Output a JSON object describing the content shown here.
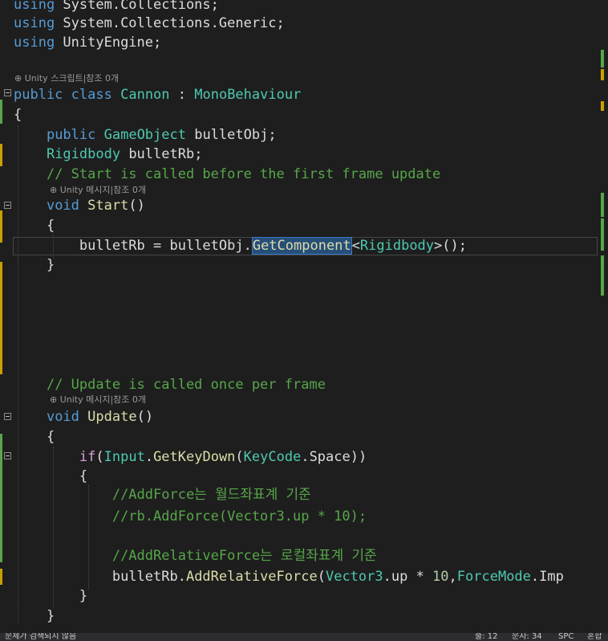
{
  "editor": {
    "lines": {
      "using1_kw": "using",
      "using1_ns": " System.Collections;",
      "using2_kw": "using",
      "using2_ns": " System.Collections.Generic;",
      "using3_kw": "using",
      "using3_ns": " UnityEngine;",
      "class_public": "public",
      "class_kw": "class",
      "class_name": "Cannon",
      "class_colon": " : ",
      "class_base": "MonoBehaviour",
      "open_brace": "{",
      "field1_public": "public",
      "field1_type": "GameObject",
      "field1_name": " bulletObj;",
      "field2_type": "Rigidbody",
      "field2_name": " bulletRb;",
      "comment_start": "// Start is called before the first frame update",
      "start_void": "void",
      "start_name": "Start",
      "start_parens": "()",
      "start_open": "{",
      "assign_lhs": "bulletRb = bulletObj.",
      "assign_method": "GetComponent",
      "assign_lt": "<",
      "assign_type": "Rigidbody",
      "assign_rest": ">();",
      "start_close": "}",
      "comment_update": "// Update is called once per frame",
      "update_void": "void",
      "update_name": "Update",
      "update_parens": "()",
      "update_open": "{",
      "if_kw": "if",
      "if_paren": "(",
      "if_input": "Input",
      "if_dot1": ".",
      "if_method": "GetKeyDown",
      "if_paren2": "(",
      "if_keycode": "KeyCode",
      "if_rest": ".Space))",
      "if_open": "{",
      "comment_addforce": "//AddForce는 월드좌표계 기준",
      "comment_rb": "//rb.AddForce(Vector3.up * 10);",
      "comment_relative": "//AddRelativeForce는 로컬좌표계 기준",
      "call_obj": "bulletRb.",
      "call_method": "AddRelativeForce",
      "call_paren": "(",
      "call_vec": "Vector3",
      "call_up": ".up * ",
      "call_num": "10",
      "call_comma": ",",
      "call_mode": "ForceMode",
      "call_tail": ".Imp",
      "if_close": "}",
      "update_close": "}"
    },
    "codelens": {
      "class_lens": "⊕ Unity 스크립트|참조 0개",
      "start_lens": "⊕ Unity 메시지|참조 0개",
      "update_lens": "⊕ Unity 메시지|참조 0개"
    },
    "colors": {
      "background": "#1e1e1e",
      "keyword": "#569cd6",
      "type": "#4ec9b0",
      "method": "#dcdcaa",
      "comment": "#57a64a",
      "control": "#d8a0df",
      "number": "#b5cea8",
      "change_bar": "#57a64a",
      "saved_bar": "#c8a000"
    }
  },
  "statusbar": {
    "problems": "문제가 검색되지 않음",
    "line": "줄: 12",
    "col": "문자: 34",
    "spc": "SPC",
    "encoding": "혼합"
  }
}
